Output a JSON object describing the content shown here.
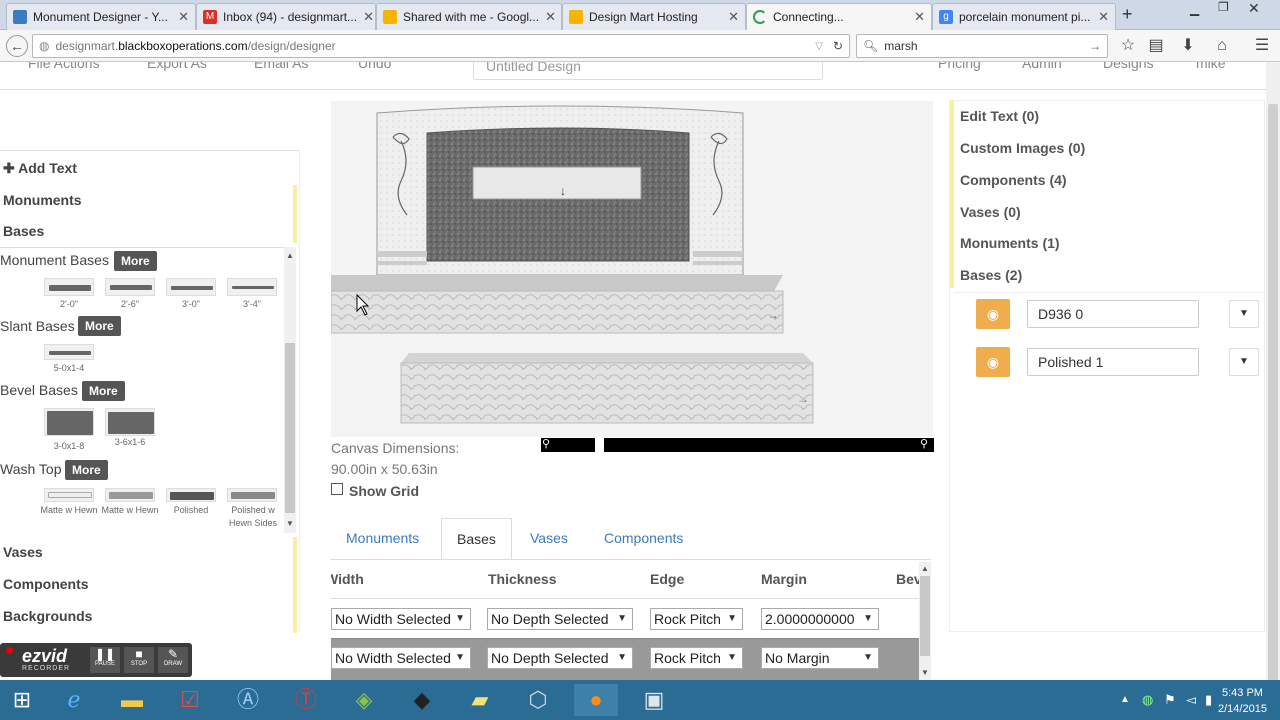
{
  "browser": {
    "tabs": [
      {
        "title": "Monument Designer - Y...",
        "icon_color": "#3b7bbf",
        "active": false
      },
      {
        "title": "Inbox (94) - designmart...",
        "icon_color": "#d93025",
        "active": false
      },
      {
        "title": "Shared with me - Googl...",
        "icon_color": "#f4b400",
        "active": false
      },
      {
        "title": "Design Mart Hosting",
        "icon_color": "#f4b400",
        "active": false
      },
      {
        "title": "Connecting...",
        "icon_color": "#2e9e4f",
        "active": true
      },
      {
        "title": "porcelain monument pi...",
        "icon_color": "#4285f4",
        "active": false
      }
    ],
    "url_prefix": "designmart.",
    "url_domain": "blackboxoperations.com",
    "url_path": "/design/designer",
    "search_value": "marsh"
  },
  "appbar": {
    "items": [
      "File Actions",
      "Export As",
      "Email As",
      "Undo",
      "Pricing",
      "Admin",
      "Designs",
      "mike"
    ],
    "doc_name": "Untitled Design"
  },
  "left_panel": {
    "add_text": "Add Text",
    "monuments": "Monuments",
    "bases": "Bases",
    "more_label": "More",
    "groups": {
      "monument_bases": {
        "label": "Monument Bases",
        "items": [
          "2'-0\"",
          "2'-6\"",
          "3'-0\"",
          "3'-4\""
        ]
      },
      "slant_bases": {
        "label": "Slant Bases",
        "items": [
          "5-0x1-4"
        ]
      },
      "bevel_bases": {
        "label": "Bevel Bases",
        "items": [
          "3-0x1-8",
          "3-6x1-6"
        ]
      },
      "wash_top": {
        "label": "Wash Top",
        "items": [
          "Matte w Hewn",
          "Matte w Hewn",
          "Polished",
          "Polished w Hewn Sides"
        ]
      }
    },
    "vases": "Vases",
    "components": "Components",
    "backgrounds": "Backgrounds"
  },
  "canvas": {
    "dimensions_label": "Canvas Dimensions:",
    "dimensions_value": "90.00in x 50.63in",
    "show_grid": "Show Grid"
  },
  "bottom_tabs": [
    "Monuments",
    "Bases",
    "Vases",
    "Components"
  ],
  "bases_table": {
    "columns": [
      "Width",
      "Thickness",
      "Edge",
      "Margin",
      "Bevel"
    ],
    "rows": [
      [
        "No Width Selected",
        "No Depth Selected",
        "Rock Pitch",
        "2.0000000000"
      ],
      [
        "No Width Selected",
        "No Depth Selected",
        "Rock Pitch",
        "No Margin"
      ]
    ]
  },
  "right_panel": {
    "edit_text": "Edit Text (0)",
    "custom_images": "Custom Images (0)",
    "components": "Components (4)",
    "vases": "Vases (0)",
    "monuments": "Monuments (1)",
    "bases": "Bases (2)",
    "base_items": [
      "D936 0",
      "Polished 1"
    ]
  },
  "recorder": {
    "brand": "ezvid",
    "sub": "RECORDER",
    "buttons": [
      "PAUSE",
      "STOP",
      "DRAW"
    ]
  },
  "taskbar": {
    "time": "5:43 PM",
    "date": "2/14/2015"
  },
  "colors": {
    "accent": "#f0ad4e",
    "link": "#3b7bbf",
    "panel_bar": "#f7efa4",
    "taskbar": "#2a6c93"
  }
}
